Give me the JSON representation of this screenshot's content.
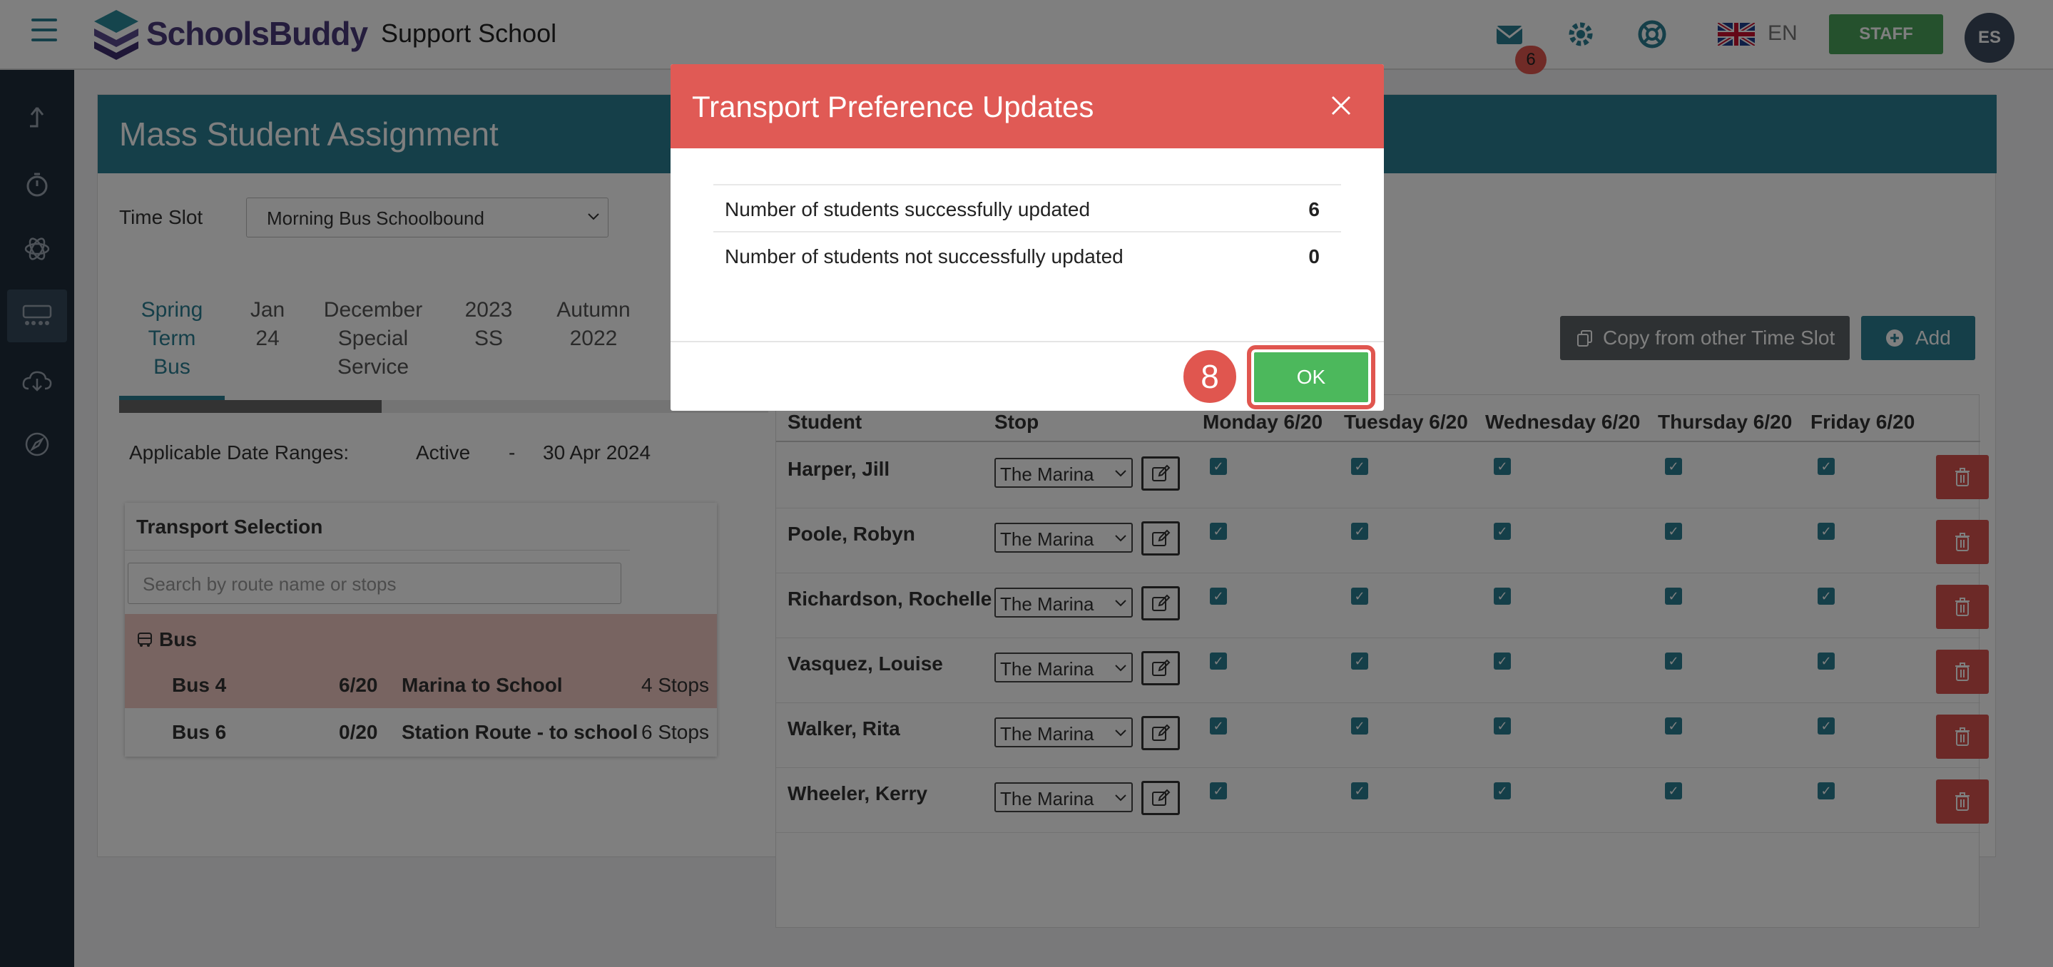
{
  "header": {
    "logo_text": "SchoolsBuddy",
    "school_name": "Support School",
    "mail_count": "6",
    "language": "EN",
    "staff_label": "STAFF",
    "avatar_initials": "ES"
  },
  "sidebar": {
    "items": [
      "share-icon",
      "stopwatch-icon",
      "atom-icon",
      "transport-icon",
      "cloud-download-icon",
      "compass-icon"
    ]
  },
  "page": {
    "title": "Mass Student Assignment",
    "time_slot_label": "Time Slot",
    "time_slot_value": "Morning Bus Schoolbound",
    "tabs": [
      {
        "label": "Spring Term Bus",
        "lines": [
          "Spring",
          "Term",
          "Bus"
        ]
      },
      {
        "label": "Jan 24",
        "lines": [
          "Jan",
          "24"
        ]
      },
      {
        "label": "December Special Service",
        "lines": [
          "December",
          "Special",
          "Service"
        ]
      },
      {
        "label": "2023 SS",
        "lines": [
          "2023",
          "SS"
        ]
      },
      {
        "label": "Autumn 2022",
        "lines": [
          "Autumn",
          "2022"
        ]
      }
    ],
    "date_ranges_label": "Applicable Date Ranges:",
    "date_active": "Active",
    "date_dash": "-",
    "date_end": "30 Apr 2024"
  },
  "transport": {
    "title": "Transport Selection",
    "search_placeholder": "Search by route name or stops",
    "group_label": "Bus",
    "routes": [
      {
        "name": "Bus 4",
        "capacity": "6/20",
        "route": "Marina to School",
        "stops": "4 Stops"
      },
      {
        "name": "Bus 6",
        "capacity": "0/20",
        "route": "Station Route - to school",
        "stops": "6 Stops"
      }
    ]
  },
  "actions": {
    "copy_label": "Copy from other Time Slot",
    "add_label": "Add"
  },
  "grid": {
    "columns": [
      "Student",
      "Stop",
      "Monday 6/20",
      "Tuesday 6/20",
      "Wednesday 6/20",
      "Thursday 6/20",
      "Friday 6/20"
    ],
    "rows": [
      {
        "student": "Harper, Jill",
        "stop": "The Marina"
      },
      {
        "student": "Poole, Robyn",
        "stop": "The Marina"
      },
      {
        "student": "Richardson, Rochelle",
        "stop": "The Marina"
      },
      {
        "student": "Vasquez, Louise",
        "stop": "The Marina"
      },
      {
        "student": "Walker, Rita",
        "stop": "The Marina"
      },
      {
        "student": "Wheeler, Kerry",
        "stop": "The Marina"
      }
    ]
  },
  "modal": {
    "title": "Transport Preference Updates",
    "success_label": "Number of students successfully updated",
    "success_value": "6",
    "fail_label": "Number of students not successfully updated",
    "fail_value": "0",
    "ok_label": "OK",
    "step_number": "8"
  },
  "colors": {
    "teal": "#2b7f93",
    "modal_red": "#e05a55",
    "ok_green": "#4cb85c",
    "sidebar": "#1e2d3b"
  }
}
